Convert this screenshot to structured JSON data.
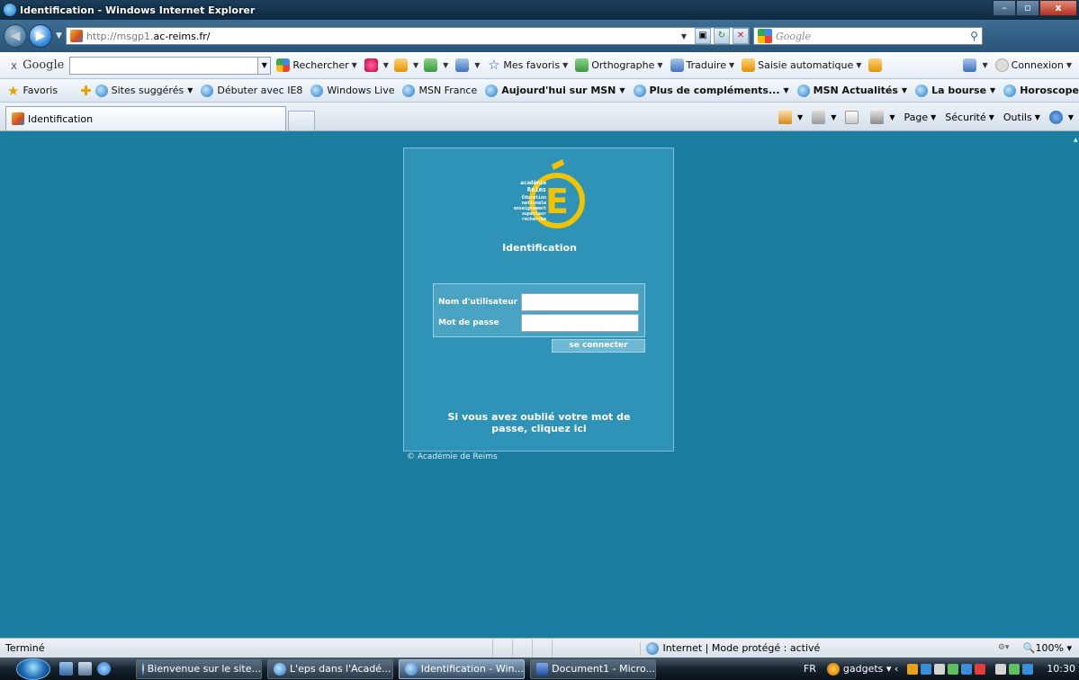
{
  "window": {
    "title": "Identification - Windows Internet Explorer"
  },
  "address": {
    "url_prefix": "http://msgp1.",
    "url_domain": "ac-reims.fr/",
    "search_placeholder": "Google"
  },
  "google_toolbar": {
    "close": "x",
    "logo": "Google",
    "search_value": "",
    "tools": [
      {
        "label": "Rechercher",
        "icon": "google-icon"
      },
      {
        "label": "Mes favoris",
        "icon": "star-icon"
      },
      {
        "label": "Orthographe",
        "icon": "spellcheck-icon"
      },
      {
        "label": "Traduire",
        "icon": "translate-icon"
      },
      {
        "label": "Saisie automatique",
        "icon": "autofill-icon"
      }
    ],
    "connexion": "Connexion"
  },
  "favorites": {
    "favoris": "Favoris",
    "items": [
      {
        "label": "Sites suggérés",
        "bold": false,
        "dropdown": true
      },
      {
        "label": "Débuter avec IE8",
        "bold": false,
        "dropdown": false
      },
      {
        "label": "Windows Live",
        "bold": false,
        "dropdown": false
      },
      {
        "label": "MSN France",
        "bold": false,
        "dropdown": false
      },
      {
        "label": "Aujourd'hui sur MSN",
        "bold": true,
        "dropdown": true
      },
      {
        "label": "Plus de compléments...",
        "bold": true,
        "dropdown": true
      },
      {
        "label": "MSN Actualités",
        "bold": true,
        "dropdown": true
      },
      {
        "label": "La bourse",
        "bold": true,
        "dropdown": true
      },
      {
        "label": "Horoscope",
        "bold": true,
        "dropdown": true
      }
    ]
  },
  "tabs": {
    "active": "Identification"
  },
  "commandbar": {
    "page": "Page",
    "securite": "Sécurité",
    "outils": "Outils"
  },
  "page": {
    "logo_lines": [
      "académie",
      "Reims",
      "Éducation",
      "nationale",
      "enseignement",
      "supérieur",
      "recherche"
    ],
    "heading": "Identification",
    "username_label": "Nom d'utilisateur",
    "password_label": "Mot de passe",
    "username_value": "",
    "password_value": "",
    "login_button": "se connecter",
    "forgot_line1": "Si vous avez oublié votre mot de",
    "forgot_line2": "passe, cliquez ici",
    "copyright": "© Académie de Reims"
  },
  "status": {
    "text": "Terminé",
    "zone": "Internet | Mode protégé : activé",
    "zoom": "100%"
  },
  "taskbar": {
    "buttons": [
      {
        "label": "Bienvenue sur le site...",
        "icon": "ie",
        "active": false
      },
      {
        "label": "L'eps dans l'Acadé...",
        "icon": "ie",
        "active": false
      },
      {
        "label": "Identification - Win...",
        "icon": "ie",
        "active": true
      },
      {
        "label": "Document1 - Micro...",
        "icon": "word",
        "active": false
      }
    ],
    "lang": "FR",
    "gadgets": "gadgets",
    "clock": "10:30"
  },
  "colors": {
    "page_background": "#1b7ea1",
    "panel_background": "#2f93b7",
    "logo_yellow": "#f2c400"
  }
}
